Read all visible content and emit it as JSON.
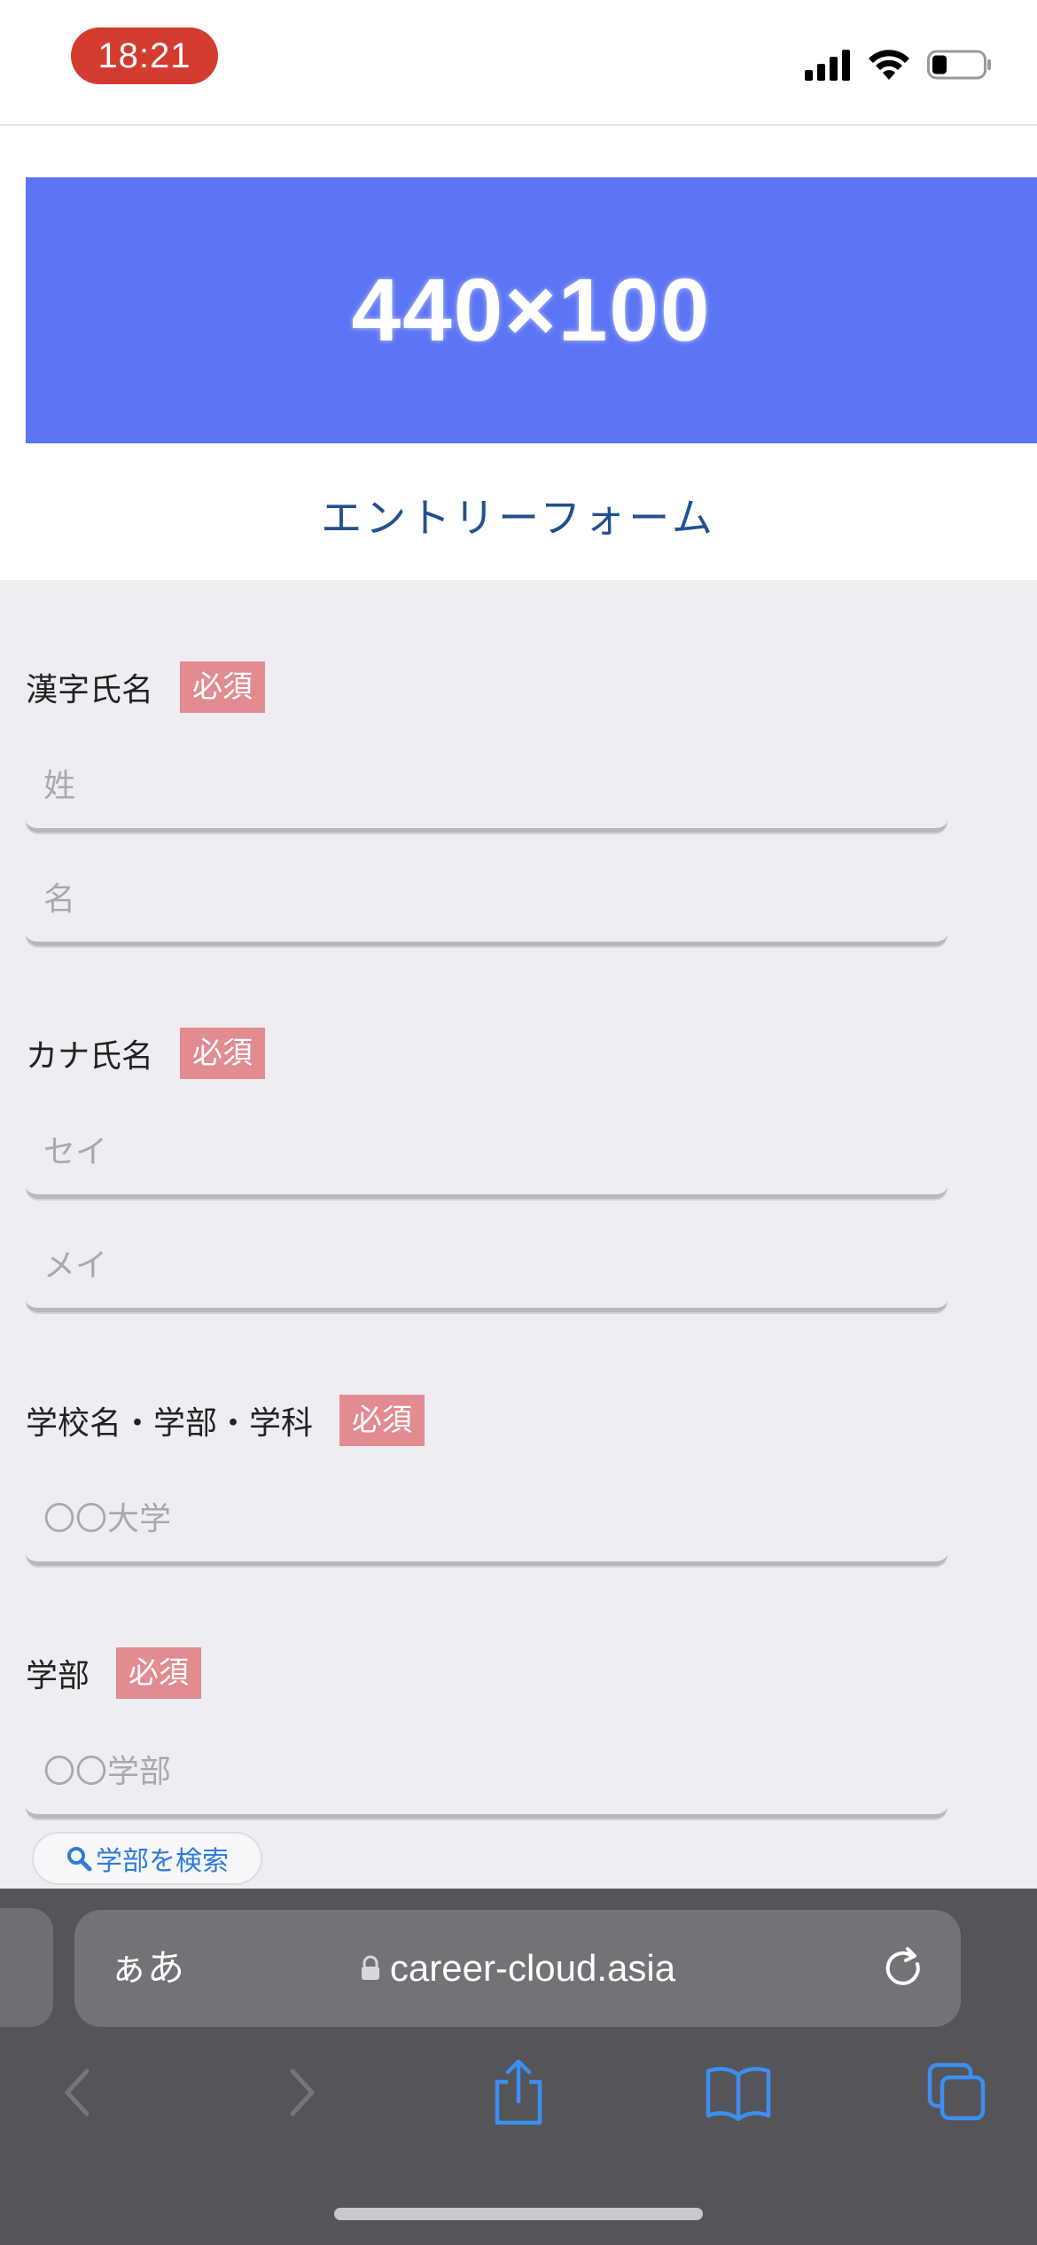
{
  "status_bar": {
    "time": "18:21"
  },
  "banner": {
    "text": "440×100",
    "color": "#5b75f4"
  },
  "form": {
    "title": "エントリーフォーム",
    "required_badge": "必須",
    "sections": [
      {
        "label": "漢字氏名",
        "fields": [
          {
            "placeholder": "姓"
          },
          {
            "placeholder": "名"
          }
        ]
      },
      {
        "label": "カナ氏名",
        "fields": [
          {
            "placeholder": "セイ"
          },
          {
            "placeholder": "メイ"
          }
        ]
      },
      {
        "label": "学校名・学部・学科",
        "fields": [
          {
            "placeholder": "〇〇大学"
          }
        ]
      },
      {
        "label": "学部",
        "fields": [
          {
            "placeholder": "〇〇学部"
          }
        ]
      }
    ],
    "search_faculty_label": "学部を検索"
  },
  "browser": {
    "text_size_label": "ぁあ",
    "url": "career-cloud.asia"
  },
  "colors": {
    "accent": "#2f7bd8",
    "required": "#e28b91",
    "title": "#24508f"
  }
}
